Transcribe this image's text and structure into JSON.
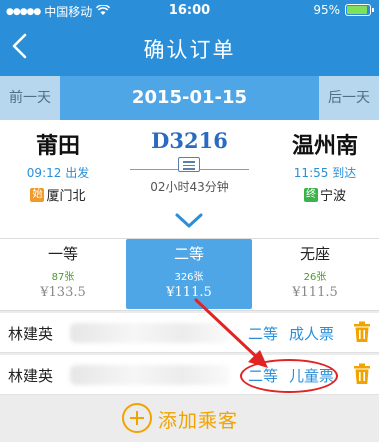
{
  "status_bar": {
    "carrier": "中国移动",
    "time": "16:00",
    "battery": "95%"
  },
  "nav": {
    "title": "确认订单",
    "back_icon": "chevron-left-icon"
  },
  "date_bar": {
    "prev_label": "前一天",
    "date": "2015-01-15",
    "next_label": "后一天"
  },
  "train": {
    "number": "D3216",
    "duration": "02小时43分钟",
    "from": {
      "station": "莆田",
      "time_line": "09:12 出发",
      "tag": "始",
      "endpoint": "厦门北"
    },
    "to": {
      "station": "温州南",
      "time_line": "11:55 到达",
      "tag": "终",
      "endpoint": "宁波"
    }
  },
  "seat_types": [
    {
      "name": "一等",
      "count": "87张",
      "price": "¥133.5",
      "selected": false
    },
    {
      "name": "二等",
      "count": "326张",
      "price": "¥111.5",
      "selected": true
    },
    {
      "name": "无座",
      "count": "26张",
      "price": "¥111.5",
      "selected": false
    }
  ],
  "passengers": [
    {
      "name": "林建英",
      "seat_class": "二等",
      "ticket_type": "成人票"
    },
    {
      "name": "林建英",
      "seat_class": "二等",
      "ticket_type": "儿童票"
    }
  ],
  "add_passenger_label": "添加乘客",
  "colors": {
    "primary": "#2a8fd8",
    "date_bar": "#4fa6e6",
    "accent_orange": "#f1a300",
    "annotation_red": "#e02424"
  }
}
